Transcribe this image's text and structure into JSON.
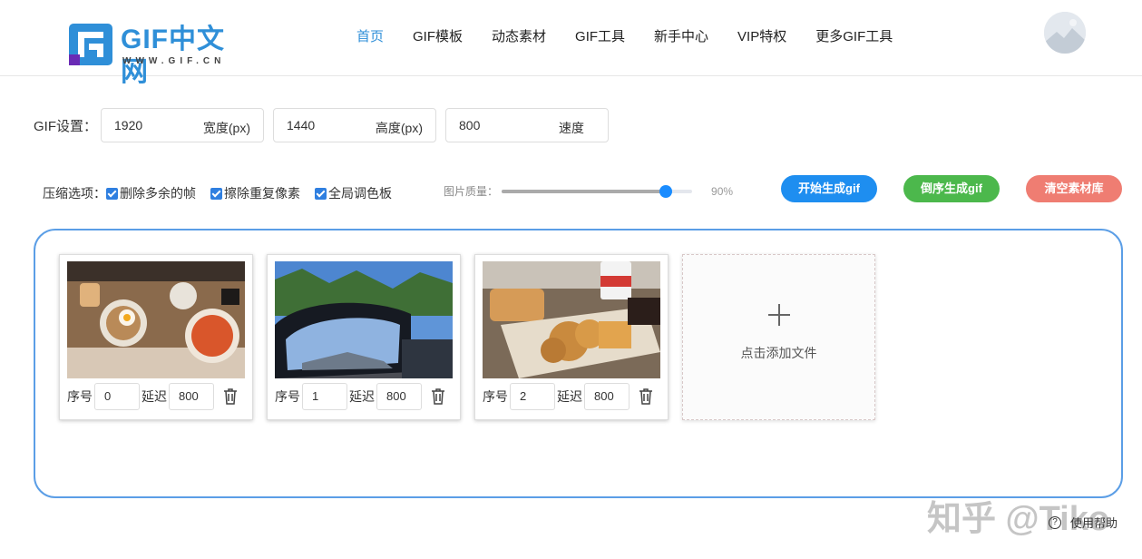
{
  "header": {
    "logo_text": "GIF中文网",
    "logo_sub": "WWW.GIF.CN",
    "nav": [
      "首页",
      "GIF模板",
      "动态素材",
      "GIF工具",
      "新手中心",
      "VIP特权",
      "更多GIF工具"
    ],
    "active_nav": "首页"
  },
  "settings": {
    "label": "GIF设置：",
    "width": {
      "value": "1920",
      "unit": "宽度(px)"
    },
    "height": {
      "value": "1440",
      "unit": "高度(px)"
    },
    "speed": {
      "value": "800",
      "unit": "速度"
    }
  },
  "compress": {
    "label": "压缩选项：",
    "options": [
      {
        "label": "删除多余的帧",
        "checked": true
      },
      {
        "label": "擦除重复像素",
        "checked": true
      },
      {
        "label": "全局调色板",
        "checked": true
      }
    ]
  },
  "quality": {
    "label": "图片质量：",
    "value": "90%",
    "level": 0.9
  },
  "buttons": {
    "start": "开始生成gif",
    "reverse": "倒序生成gif",
    "clear": "清空素材库"
  },
  "frames": [
    {
      "order_label": "序号",
      "order": "0",
      "delay_label": "延迟",
      "delay": "800",
      "image": "food-table-photo"
    },
    {
      "order_label": "序号",
      "order": "1",
      "delay_label": "延迟",
      "delay": "800",
      "image": "car-side-mirror-photo"
    },
    {
      "order_label": "序号",
      "order": "2",
      "delay_label": "延迟",
      "delay": "800",
      "image": "fried-chicken-waffle-photo"
    }
  ],
  "add_file": {
    "label": "点击添加文件"
  },
  "help": {
    "label": "使用帮助"
  },
  "watermark": "知乎 @Tiko",
  "colors": {
    "accent": "#2f8fd8",
    "start": "#1e8ef0",
    "reverse": "#4cb84c",
    "clear": "#ef7d72",
    "workspace_border": "#5b9ee6"
  }
}
